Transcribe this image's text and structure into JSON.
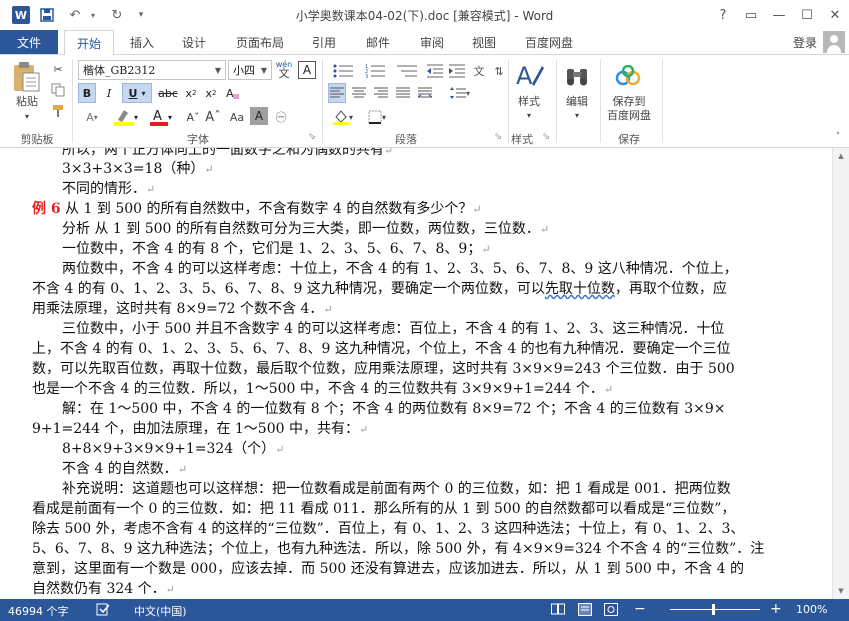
{
  "titlebar": {
    "title": "小学奥数课本04-02(下).doc [兼容模式] - Word",
    "help": "?",
    "restore_ribbon": "▭",
    "minimize": "—",
    "maximize": "☐",
    "close": "✕"
  },
  "tabs": {
    "file": "文件",
    "items": [
      "开始",
      "插入",
      "设计",
      "页面布局",
      "引用",
      "邮件",
      "审阅",
      "视图",
      "百度网盘"
    ],
    "login": "登录"
  },
  "ribbon": {
    "clipboard": {
      "paste": "粘贴",
      "group": "剪贴板"
    },
    "font": {
      "font_name": "楷体_GB2312",
      "font_size": "小四",
      "wen": "wén",
      "group": "字体"
    },
    "paragraph": {
      "group": "段落"
    },
    "styles": {
      "label": "样式",
      "group": "样式"
    },
    "editing": {
      "label": "编辑"
    },
    "save": {
      "label1": "保存到",
      "label2": "百度网盘",
      "group": "保存"
    }
  },
  "doc": {
    "lines": [
      "所以，两个正方体向上的一面数字之和为偶数的共有",
      "3×3+3×3=18（种）",
      "不同的情形．",
      "从 1 到 500 的所有自然数中，不含有数字 4 的自然数有多少个？",
      "分析  从 1 到 500 的所有自然数可分为三大类，即一位数，两位数，三位数．",
      "一位数中，不含 4 的有 8 个，它们是 1、2、3、5、6、7、8、9；",
      "两位数中，不含 4 的可以这样考虑：十位上，不含 4 的有 1、2、3、5、6、7、8、9 这八种情况．个位上，",
      "不含 4 的有 0、1、2、3、5、6、7、8、9 这九种情况，要确定一个两位数，可以",
      "先取十位数",
      "，再取个位数，应",
      "用乘法原理，这时共有 8×9=72 个数不含 4．",
      "三位数中，小于 500 并且不含数字 4 的可以这样考虑：百位上，不含 4 的有 1、2、3、这三种情况．十位",
      "上，不含 4 的有 0、1、2、3、5、6、7、8、9 这九种情况，个位上，不含 4 的也有九种情况．要确定一个三位",
      "数，可以先取百位数，再取十位数，最后取个位数，应用乘法原理，这时共有 3×9×9=243 个三位数．由于 500",
      "也是一个不含 4 的三位数．所以，1～500 中，不含 4 的三位数共有 3×9×9+1=244 个．",
      "解：在 1～500 中，不含 4 的一位数有 8 个；不含 4 的两位数有 8×9=72 个；不含 4 的三位数有 3×9×",
      "9+1=244 个，由加法原理，在 1～500 中，共有：",
      "8+8×9+3×9×9+1=324（个）",
      "不含 4 的自然数．",
      "补充说明：这道题也可以这样想：把一位数看成是前面有两个 0 的三位数，如：把 1 看成是 001．把两位数",
      "看成是前面有一个 0 的三位数．如：把 11 看成 011．那么所有的从 1 到 500 的自然数都可以看成是“三位数”，",
      "除去 500 外，考虑不含有 4 的这样的“三位数”．百位上，有 0、1、2、3 这四种选法；十位上，有 0、1、2、3、",
      "5、6、7、8、9 这九种选法；个位上，也有九种选法．所以，除 500 外，有 4×9×9=324 个不含 4 的“三位数”．注",
      "意到，这里面有一个数是 000，应该去掉．而 500 还没有算进去，应该加进去．所以，从 1 到 500 中，不含 4 的",
      "自然数仍有 324 个．"
    ],
    "example_label": "例 6",
    "para_mark": "↵"
  },
  "status": {
    "words": "46994 个字",
    "lang": "中文(中国)",
    "zoom": "100%",
    "zoom_minus": "−",
    "zoom_plus": "+"
  }
}
